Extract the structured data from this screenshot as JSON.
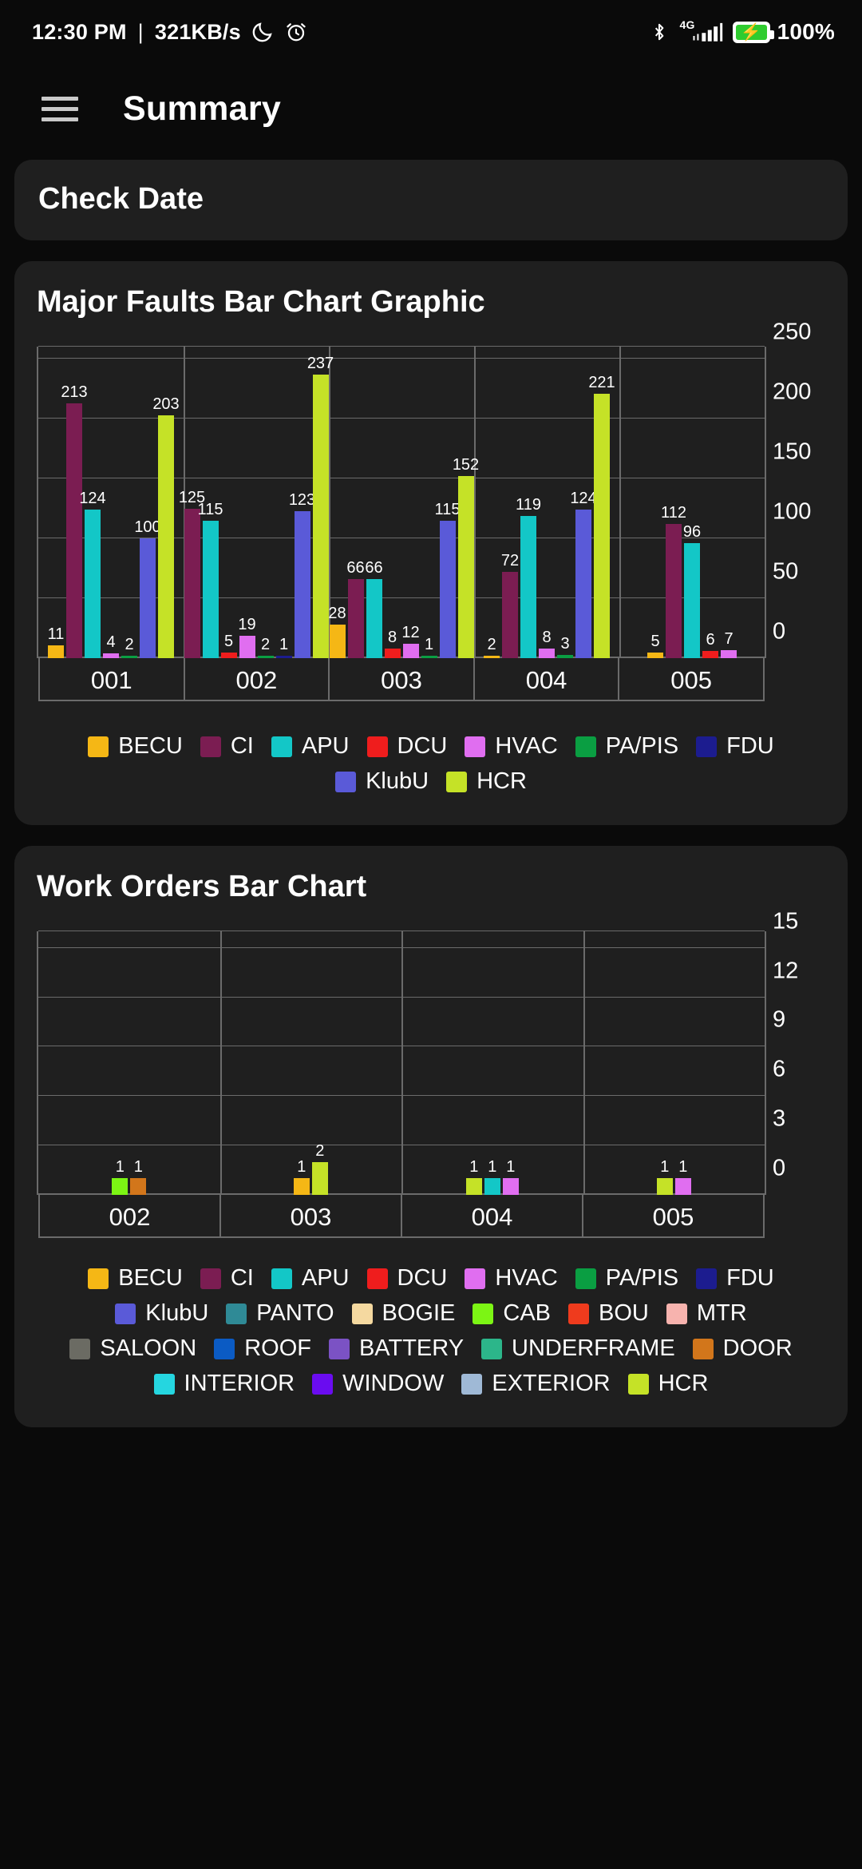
{
  "status_bar": {
    "time": "12:30 PM",
    "separator": "|",
    "net_speed": "321KB/s",
    "moon_icon": "moon-icon",
    "alarm_icon": "alarm-icon",
    "bluetooth_icon": "bluetooth-icon",
    "network_type": "4G",
    "battery_bolt": "⚡",
    "battery_percent": "100%"
  },
  "app_bar": {
    "menu_icon": "hamburger-menu-icon",
    "title": "Summary"
  },
  "check_date_card": {
    "title": "Check Date"
  },
  "chart_data": [
    {
      "id": "major-faults",
      "type": "bar",
      "title": "Major Faults Bar Chart Graphic",
      "categories": [
        "001",
        "002",
        "003",
        "004",
        "005"
      ],
      "ylabel": "",
      "xlabel": "",
      "ylim": [
        0,
        260
      ],
      "yticks": [
        0,
        50,
        100,
        150,
        200,
        250
      ],
      "ytick_labels": [
        "0",
        "50",
        "100",
        "150",
        "200",
        "250"
      ],
      "grid": true,
      "legend_position": "bottom",
      "series": [
        {
          "name": "BECU",
          "color": "#f5b715",
          "values": [
            11,
            0,
            28,
            2,
            5
          ]
        },
        {
          "name": "CI",
          "color": "#7b1d52",
          "values": [
            213,
            125,
            66,
            72,
            112
          ]
        },
        {
          "name": "APU",
          "color": "#13c7c7",
          "values": [
            124,
            115,
            66,
            119,
            96
          ]
        },
        {
          "name": "DCU",
          "color": "#ef1d1d",
          "values": [
            0,
            5,
            8,
            0,
            6
          ]
        },
        {
          "name": "HVAC",
          "color": "#e06ef0",
          "values": [
            4,
            19,
            12,
            8,
            7
          ]
        },
        {
          "name": "PA/PIS",
          "color": "#0a9e42",
          "values": [
            2,
            2,
            1,
            3,
            0
          ]
        },
        {
          "name": "FDU",
          "color": "#1c1c8f",
          "values": [
            0,
            1,
            0,
            0,
            0
          ]
        },
        {
          "name": "KlubU",
          "color": "#5a5ad8",
          "values": [
            100,
            123,
            115,
            124,
            0
          ]
        },
        {
          "name": "HCR",
          "color": "#c5e227",
          "values": [
            203,
            237,
            152,
            221,
            0
          ]
        }
      ],
      "bar_labels": [
        {
          "group": "001",
          "series": "BECU",
          "text": "11"
        },
        {
          "group": "001",
          "series": "CI",
          "text": "213"
        },
        {
          "group": "001",
          "series": "APU",
          "text": "124"
        },
        {
          "group": "001",
          "series": "HVAC",
          "text": "4"
        },
        {
          "group": "001",
          "series": "PA/PIS",
          "text": "2"
        },
        {
          "group": "001",
          "series": "KlubU",
          "text": "100"
        },
        {
          "group": "001",
          "series": "HCR",
          "text": "203"
        },
        {
          "group": "002",
          "series": "CI",
          "text": "125"
        },
        {
          "group": "002",
          "series": "APU",
          "text": "115"
        },
        {
          "group": "002",
          "series": "DCU",
          "text": "5"
        },
        {
          "group": "002",
          "series": "HVAC",
          "text": "19"
        },
        {
          "group": "002",
          "series": "PA/PIS",
          "text": "2"
        },
        {
          "group": "002",
          "series": "FDU",
          "text": "1"
        },
        {
          "group": "002",
          "series": "KlubU",
          "text": "123"
        },
        {
          "group": "002",
          "series": "HCR",
          "text": "237"
        },
        {
          "group": "003",
          "series": "BECU",
          "text": "28"
        },
        {
          "group": "003",
          "series": "CI",
          "text": "66"
        },
        {
          "group": "003",
          "series": "APU",
          "text": "66"
        },
        {
          "group": "003",
          "series": "DCU",
          "text": "8"
        },
        {
          "group": "003",
          "series": "HVAC",
          "text": "12"
        },
        {
          "group": "003",
          "series": "PA/PIS",
          "text": "1"
        },
        {
          "group": "003",
          "series": "KlubU",
          "text": "115"
        },
        {
          "group": "003",
          "series": "HCR",
          "text": "152"
        },
        {
          "group": "004",
          "series": "BECU",
          "text": "2"
        },
        {
          "group": "004",
          "series": "CI",
          "text": "72"
        },
        {
          "group": "004",
          "series": "APU",
          "text": "119"
        },
        {
          "group": "004",
          "series": "HVAC",
          "text": "8"
        },
        {
          "group": "004",
          "series": "PA/PIS",
          "text": "3"
        },
        {
          "group": "004",
          "series": "KlubU",
          "text": "124"
        },
        {
          "group": "004",
          "series": "HCR",
          "text": "221"
        },
        {
          "group": "005",
          "series": "BECU",
          "text": "5"
        },
        {
          "group": "005",
          "series": "CI",
          "text": "112"
        },
        {
          "group": "005",
          "series": "APU",
          "text": "96"
        },
        {
          "group": "005",
          "series": "DCU",
          "text": "6"
        },
        {
          "group": "005",
          "series": "HVAC",
          "text": "7"
        }
      ],
      "legend": [
        {
          "label": "BECU",
          "color": "#f5b715"
        },
        {
          "label": "CI",
          "color": "#7b1d52"
        },
        {
          "label": "APU",
          "color": "#13c7c7"
        },
        {
          "label": "DCU",
          "color": "#ef1d1d"
        },
        {
          "label": "HVAC",
          "color": "#e06ef0"
        },
        {
          "label": "PA/PIS",
          "color": "#0a9e42"
        },
        {
          "label": "FDU",
          "color": "#1c1c8f"
        },
        {
          "label": "KlubU",
          "color": "#5a5ad8"
        },
        {
          "label": "HCR",
          "color": "#c5e227"
        }
      ]
    },
    {
      "id": "work-orders",
      "type": "bar",
      "title": "Work Orders Bar Chart",
      "categories": [
        "002",
        "003",
        "004",
        "005"
      ],
      "ylabel": "",
      "xlabel": "",
      "ylim": [
        0,
        16
      ],
      "yticks": [
        0,
        3,
        6,
        9,
        12,
        15
      ],
      "ytick_labels": [
        "0",
        "3",
        "6",
        "9",
        "12",
        "15"
      ],
      "grid": true,
      "legend_position": "bottom",
      "series": [
        {
          "name": "CAB",
          "color": "#7cf514",
          "values": [
            1,
            0,
            0,
            0
          ]
        },
        {
          "name": "DOOR",
          "color": "#d2761b",
          "values": [
            1,
            0,
            0,
            0
          ]
        },
        {
          "name": "BECU",
          "color": "#f5b715",
          "values": [
            0,
            1,
            0,
            0
          ]
        },
        {
          "name": "HCR",
          "color": "#c5e227",
          "values": [
            0,
            2,
            1,
            1
          ]
        },
        {
          "name": "APU",
          "color": "#13c7c7",
          "values": [
            0,
            0,
            1,
            0
          ]
        },
        {
          "name": "HVAC",
          "color": "#e06ef0",
          "values": [
            0,
            0,
            1,
            1
          ]
        }
      ],
      "bar_labels": [
        {
          "group": "002",
          "series": "CAB",
          "text": "1"
        },
        {
          "group": "002",
          "series": "DOOR",
          "text": "1"
        },
        {
          "group": "003",
          "series": "BECU",
          "text": "1"
        },
        {
          "group": "003",
          "series": "HCR",
          "text": "2"
        },
        {
          "group": "004",
          "series": "APU",
          "text": "1"
        },
        {
          "group": "004",
          "series": "HVAC",
          "text": "1"
        },
        {
          "group": "004",
          "series": "HCR",
          "text": "1"
        },
        {
          "group": "005",
          "series": "HVAC",
          "text": "1"
        },
        {
          "group": "005",
          "series": "HCR",
          "text": "1"
        }
      ],
      "legend": [
        {
          "label": "BECU",
          "color": "#f5b715"
        },
        {
          "label": "CI",
          "color": "#7b1d52"
        },
        {
          "label": "APU",
          "color": "#13c7c7"
        },
        {
          "label": "DCU",
          "color": "#ef1d1d"
        },
        {
          "label": "HVAC",
          "color": "#e06ef0"
        },
        {
          "label": "PA/PIS",
          "color": "#0a9e42"
        },
        {
          "label": "FDU",
          "color": "#1c1c8f"
        },
        {
          "label": "KlubU",
          "color": "#5a5ad8"
        },
        {
          "label": "PANTO",
          "color": "#2f8a96"
        },
        {
          "label": "BOGIE",
          "color": "#f5d9a0"
        },
        {
          "label": "CAB",
          "color": "#7cf514"
        },
        {
          "label": "BOU",
          "color": "#ef3b1d"
        },
        {
          "label": "MTR",
          "color": "#f7b3ae"
        },
        {
          "label": "SALOON",
          "color": "#6b6b63"
        },
        {
          "label": "ROOF",
          "color": "#0b5bc4"
        },
        {
          "label": "BATTERY",
          "color": "#7b52c4"
        },
        {
          "label": "UNDERFRAME",
          "color": "#2cb68a"
        },
        {
          "label": "DOOR",
          "color": "#d2761b"
        },
        {
          "label": "INTERIOR",
          "color": "#25d6e0"
        },
        {
          "label": "WINDOW",
          "color": "#6a0cf0"
        },
        {
          "label": "EXTERIOR",
          "color": "#9fb9d6"
        },
        {
          "label": "HCR",
          "color": "#c5e227"
        }
      ]
    }
  ]
}
